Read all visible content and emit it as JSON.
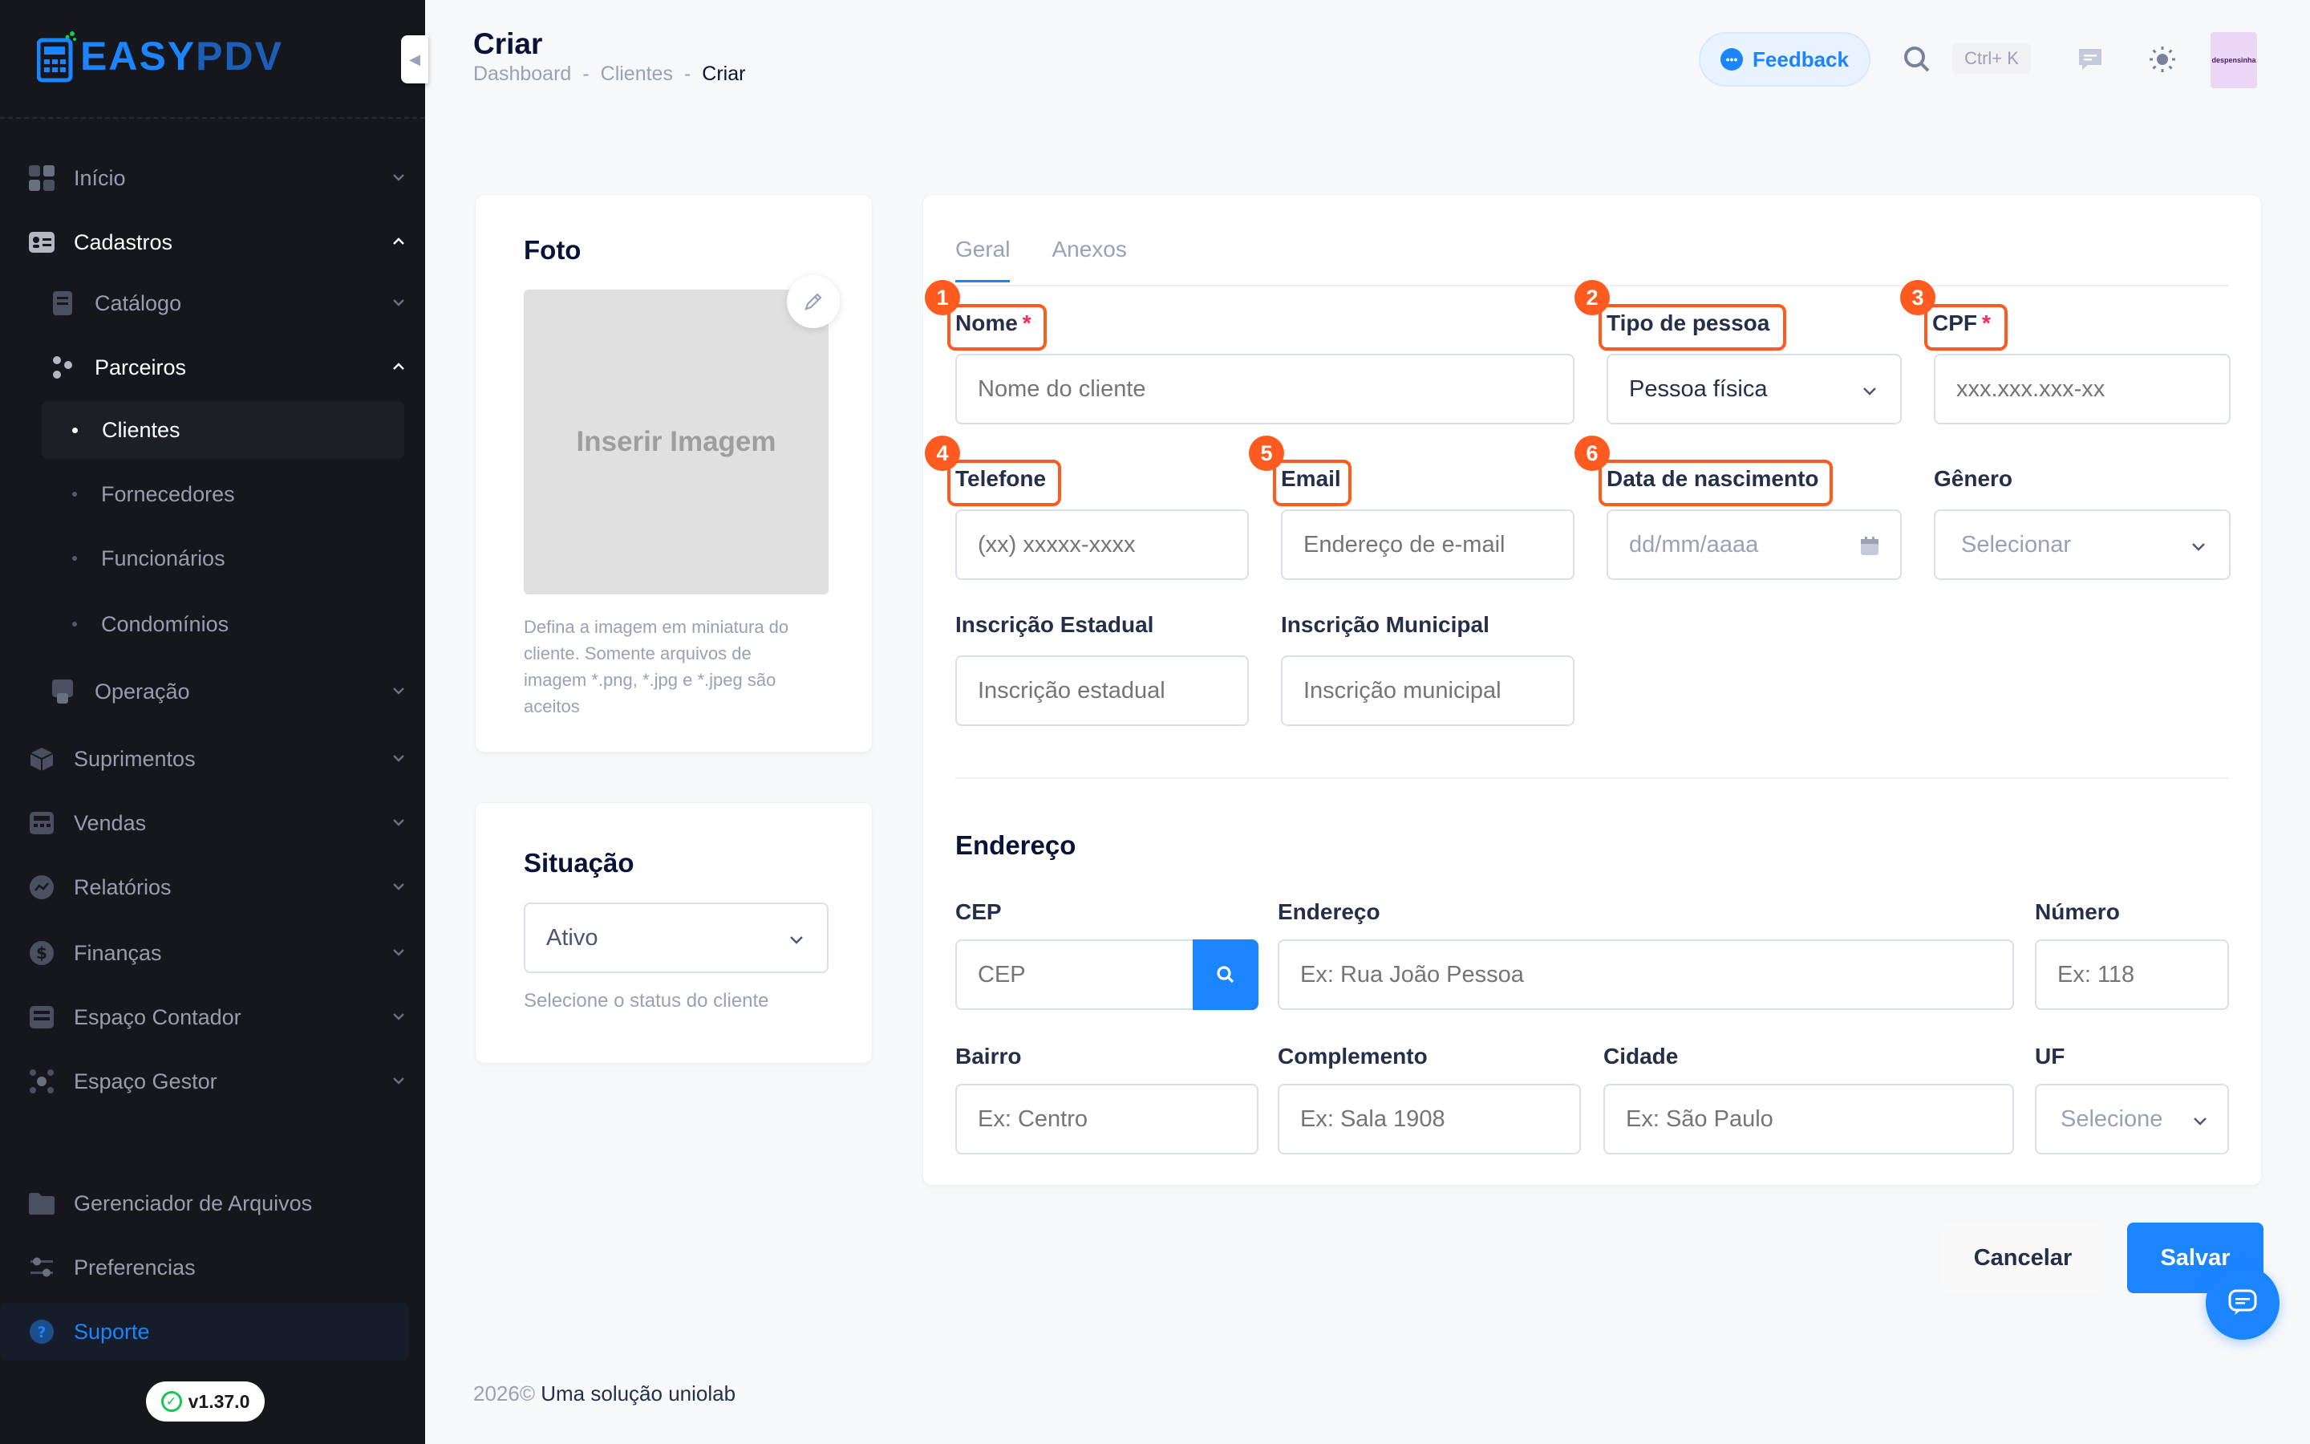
{
  "brand": {
    "logo_text_1": "EASY",
    "logo_text_2": "PDV",
    "version": "v1.37.0"
  },
  "sidebar": {
    "items": [
      {
        "label": "Início",
        "icon": "grid-icon"
      },
      {
        "label": "Cadastros",
        "icon": "id-card-icon"
      },
      {
        "label": "Catálogo",
        "icon": "book-icon"
      },
      {
        "label": "Parceiros",
        "icon": "people-icon"
      },
      {
        "label": "Clientes"
      },
      {
        "label": "Fornecedores"
      },
      {
        "label": "Funcionários"
      },
      {
        "label": "Condomínios"
      },
      {
        "label": "Operação",
        "icon": "hand-icon"
      },
      {
        "label": "Suprimentos",
        "icon": "box-icon"
      },
      {
        "label": "Vendas",
        "icon": "register-icon"
      },
      {
        "label": "Relatórios",
        "icon": "chart-icon"
      },
      {
        "label": "Finanças",
        "icon": "dollar-icon"
      },
      {
        "label": "Espaço Contador",
        "icon": "calculator-icon"
      },
      {
        "label": "Espaço Gestor",
        "icon": "network-icon"
      },
      {
        "label": "Gerenciador de Arquivos",
        "icon": "folder-icon"
      },
      {
        "label": "Preferencias",
        "icon": "sliders-icon"
      },
      {
        "label": "Suporte",
        "icon": "question-icon"
      }
    ]
  },
  "header": {
    "title": "Criar",
    "breadcrumb": [
      "Dashboard",
      "Clientes",
      "Criar"
    ],
    "breadcrumb_sep": "-",
    "feedback_label": "Feedback",
    "search_shortcut": "Ctrl+ K",
    "avatar_text": "despensinha"
  },
  "photo_card": {
    "title": "Foto",
    "placeholder": "Inserir Imagem",
    "hint_lines": [
      "Defina a imagem em miniatura do",
      "cliente. Somente arquivos de",
      "imagem *.png, *.jpg e *.jpeg são",
      "aceitos"
    ]
  },
  "status_card": {
    "title": "Situação",
    "selected": "Ativo",
    "hint": "Selecione o status do cliente"
  },
  "form": {
    "tabs": [
      "Geral",
      "Anexos"
    ],
    "fields": {
      "nome": {
        "label": "Nome",
        "required": "*",
        "placeholder": "Nome do cliente",
        "badge": "1"
      },
      "tipo_pessoa": {
        "label": "Tipo de pessoa",
        "value": "Pessoa física",
        "badge": "2"
      },
      "cpf": {
        "label": "CPF",
        "required": "*",
        "placeholder": "xxx.xxx.xxx-xx",
        "badge": "3"
      },
      "telefone": {
        "label": "Telefone",
        "placeholder": "(xx) xxxxx-xxxx",
        "badge": "4"
      },
      "email": {
        "label": "Email",
        "placeholder": "Endereço de e-mail",
        "badge": "5"
      },
      "nascimento": {
        "label": "Data de nascimento",
        "placeholder": "dd/mm/aaaa",
        "badge": "6"
      },
      "genero": {
        "label": "Gênero",
        "value": "Selecionar"
      },
      "ie": {
        "label": "Inscrição Estadual",
        "placeholder": "Inscrição estadual"
      },
      "im": {
        "label": "Inscrição Municipal",
        "placeholder": "Inscrição municipal"
      }
    },
    "address": {
      "title": "Endereço",
      "cep": {
        "label": "CEP",
        "placeholder": "CEP"
      },
      "endereco": {
        "label": "Endereço",
        "placeholder": "Ex: Rua João Pessoa"
      },
      "numero": {
        "label": "Número",
        "placeholder": "Ex: 118"
      },
      "bairro": {
        "label": "Bairro",
        "placeholder": "Ex: Centro"
      },
      "complemento": {
        "label": "Complemento",
        "placeholder": "Ex: Sala 1908"
      },
      "cidade": {
        "label": "Cidade",
        "placeholder": "Ex: São Paulo"
      },
      "uf": {
        "label": "UF",
        "value": "Selecione"
      }
    }
  },
  "actions": {
    "cancel": "Cancelar",
    "save": "Salvar"
  },
  "footer": {
    "year": "2026©",
    "text": "Uma solução uniolab"
  },
  "colors": {
    "primary": "#1b84ff",
    "sidebar_bg": "#15171c",
    "highlight": "#ff5a1f",
    "required": "#f8285a"
  }
}
